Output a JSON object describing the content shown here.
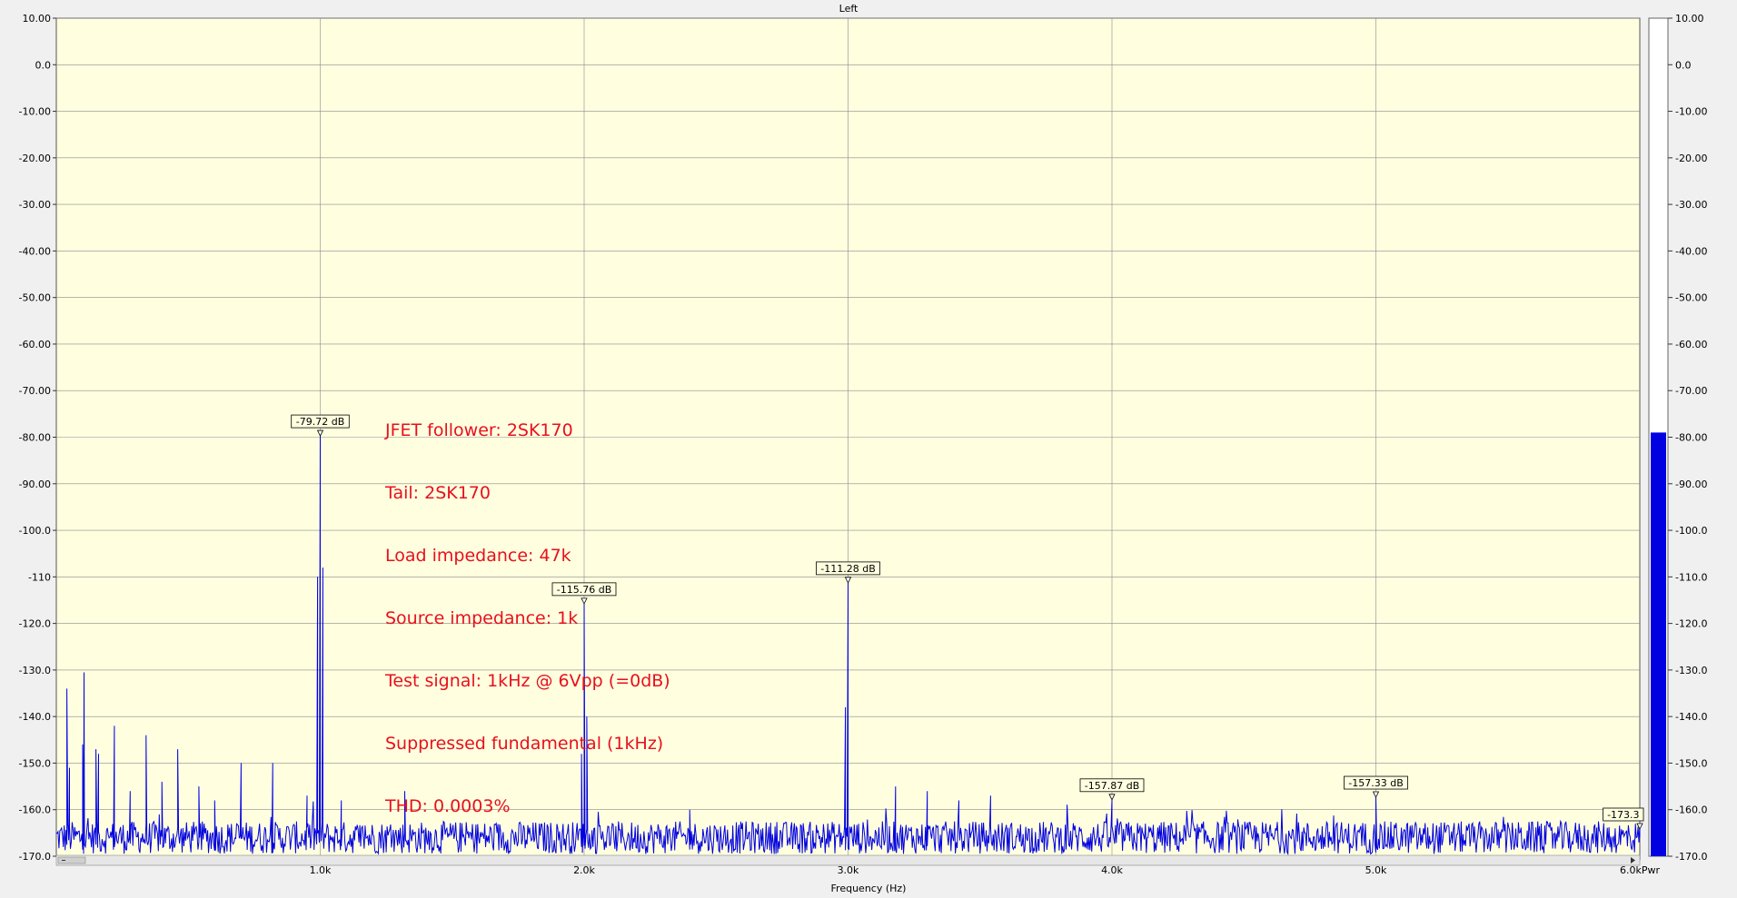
{
  "chart_data": {
    "type": "line",
    "title": "Left",
    "xlabel": "Frequency (Hz)",
    "ylabel": "",
    "xlim": [
      0,
      6000
    ],
    "ylim": [
      -170,
      10
    ],
    "grid": true,
    "x_ticks": [
      {
        "value": 1000,
        "label": "1.0k"
      },
      {
        "value": 2000,
        "label": "2.0k"
      },
      {
        "value": 3000,
        "label": "3.0k"
      },
      {
        "value": 4000,
        "label": "4.0k"
      },
      {
        "value": 5000,
        "label": "5.0k"
      },
      {
        "value": 6000,
        "label": "6.0kPwr"
      }
    ],
    "y_ticks": [
      10,
      0,
      -10,
      -20,
      -30,
      -40,
      -50,
      -60,
      -70,
      -80,
      -90,
      -100,
      -110,
      -120,
      -130,
      -140,
      -150,
      -160,
      -170
    ],
    "y_tick_labels": [
      "10.00",
      "0.0",
      "-10.00",
      "-20.00",
      "-30.00",
      "-40.00",
      "-50.00",
      "-60.00",
      "-70.00",
      "-80.00",
      "-90.00",
      "-100.0",
      "-110",
      "-120.0",
      "-130.0",
      "-140.0",
      "-150.0",
      "-160.0",
      "-170.0"
    ],
    "series": [
      {
        "color": "#0000e0",
        "noise_floor_db": -167,
        "points": [
          {
            "x": 0,
            "y": -165
          },
          {
            "x": 40,
            "y": -134
          },
          {
            "x": 50,
            "y": -151
          },
          {
            "x": 100,
            "y": -146
          },
          {
            "x": 105,
            "y": -130.5
          },
          {
            "x": 150,
            "y": -147
          },
          {
            "x": 160,
            "y": -148
          },
          {
            "x": 220,
            "y": -142
          },
          {
            "x": 280,
            "y": -156
          },
          {
            "x": 340,
            "y": -144
          },
          {
            "x": 400,
            "y": -154
          },
          {
            "x": 460,
            "y": -147
          },
          {
            "x": 540,
            "y": -155
          },
          {
            "x": 600,
            "y": -158
          },
          {
            "x": 700,
            "y": -150
          },
          {
            "x": 820,
            "y": -150
          },
          {
            "x": 950,
            "y": -157
          },
          {
            "x": 990,
            "y": -110
          },
          {
            "x": 1000,
            "y": -79.72
          },
          {
            "x": 1010,
            "y": -108
          },
          {
            "x": 1080,
            "y": -158
          },
          {
            "x": 1320,
            "y": -156
          },
          {
            "x": 1990,
            "y": -148
          },
          {
            "x": 2000,
            "y": -115.76
          },
          {
            "x": 2010,
            "y": -140
          },
          {
            "x": 2400,
            "y": -160
          },
          {
            "x": 2990,
            "y": -138
          },
          {
            "x": 3000,
            "y": -111.28
          },
          {
            "x": 3180,
            "y": -155
          },
          {
            "x": 3300,
            "y": -156
          },
          {
            "x": 3420,
            "y": -158
          },
          {
            "x": 3540,
            "y": -157
          },
          {
            "x": 4000,
            "y": -157.87
          },
          {
            "x": 5000,
            "y": -157.33
          },
          {
            "x": 6000,
            "y": -166
          }
        ]
      }
    ],
    "markers": [
      {
        "x": 1000,
        "y": -79.72,
        "label": "-79.72 dB"
      },
      {
        "x": 2000,
        "y": -115.76,
        "label": "-115.76 dB"
      },
      {
        "x": 3000,
        "y": -111.28,
        "label": "-111.28 dB"
      },
      {
        "x": 4000,
        "y": -157.87,
        "label": "-157.87 dB"
      },
      {
        "x": 5000,
        "y": -157.33,
        "label": "-157.33 dB"
      },
      {
        "x": 6000,
        "y": -173.3,
        "label": "-173.3"
      }
    ],
    "annotation_lines": [
      "JFET follower: 2SK170",
      "Tail: 2SK170",
      "Load impedance: 47k",
      "Source impedance: 1k",
      "Test signal: 1kHz @ 6Vpp (=0dB)",
      "Suppressed fundamental (1kHz)",
      "THD: 0.0003%"
    ],
    "level_meter": {
      "value_db": -79,
      "ylim": [
        -170,
        10
      ],
      "color": "#0000e0",
      "tick_labels": [
        "10.00",
        "0.0",
        "-10.00",
        "-20.00",
        "-30.00",
        "-40.00",
        "-50.00",
        "-60.00",
        "-70.00",
        "-80.00",
        "-90.00",
        "-100.0",
        "-110.0",
        "-120.0",
        "-130.0",
        "-140.0",
        "-150.0",
        "-160.0",
        "-170.0"
      ]
    }
  },
  "colors": {
    "plot_background": "#ffffe0",
    "grid": "#8a8a8a",
    "trace": "#0000e0",
    "annotation": "#e8101c"
  }
}
